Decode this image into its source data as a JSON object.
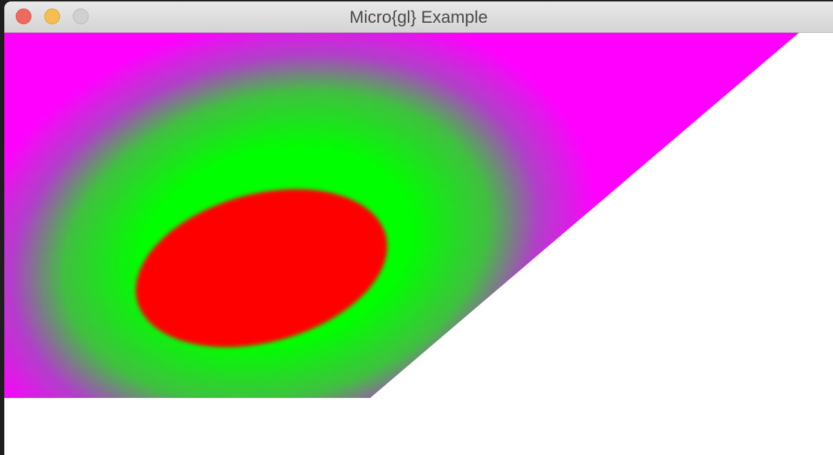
{
  "window": {
    "title": "Micro{gl} Example"
  },
  "controls": {
    "close": "close-icon",
    "minimize": "minimize-icon",
    "zoom": "zoom-icon"
  },
  "render": {
    "background": "#ffffff",
    "shape_fill_outer": "#ff00ff",
    "gradient_mid": "#00ff00",
    "ellipse_fill": "#ff0000"
  }
}
